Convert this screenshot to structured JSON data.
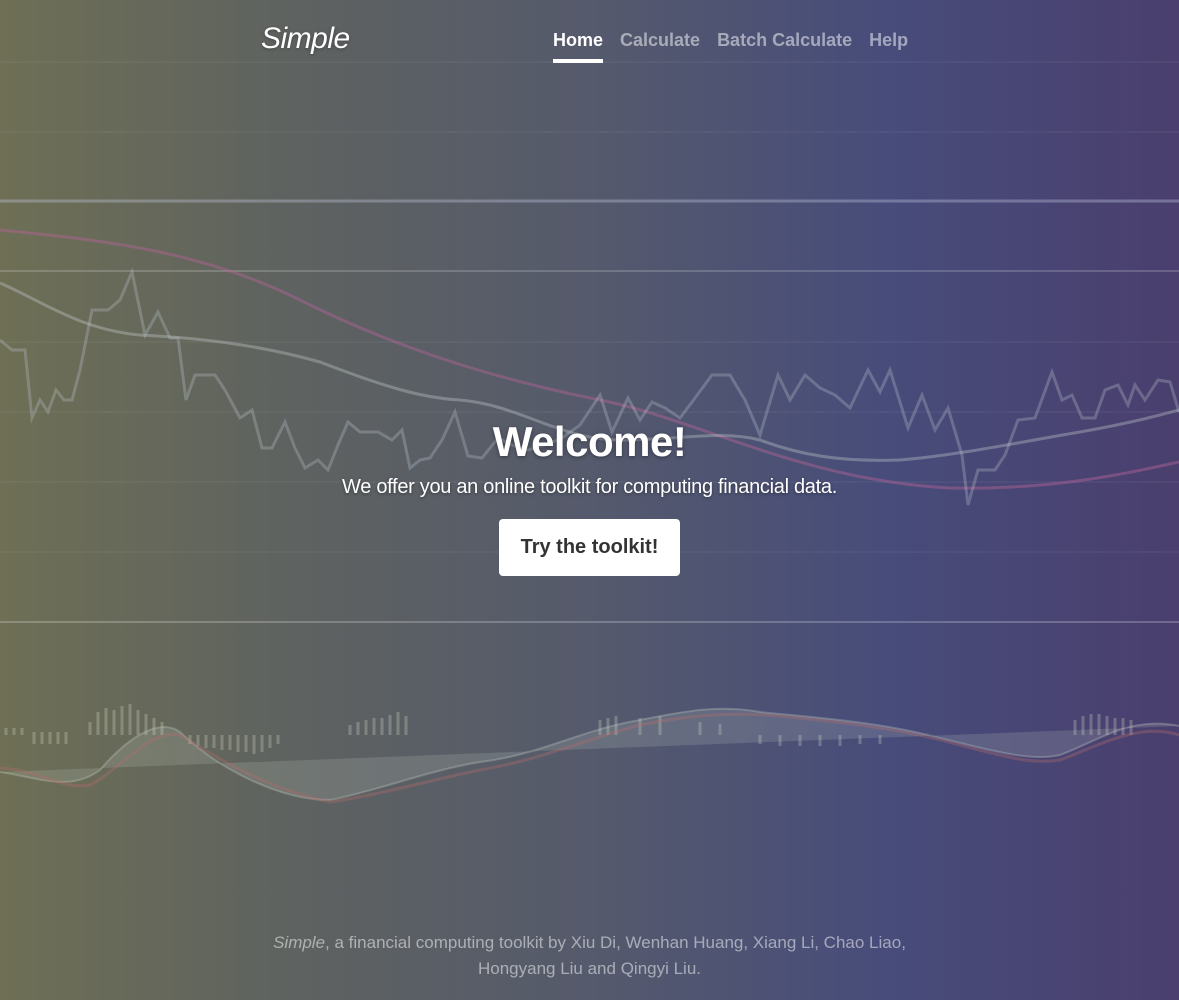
{
  "brand": "Simple",
  "nav": {
    "items": [
      {
        "label": "Home",
        "active": true
      },
      {
        "label": "Calculate",
        "active": false
      },
      {
        "label": "Batch Calculate",
        "active": false
      },
      {
        "label": "Help",
        "active": false
      }
    ]
  },
  "hero": {
    "title": "Welcome!",
    "subtitle": "We offer you an online toolkit for computing financial data.",
    "cta_label": "Try the toolkit!"
  },
  "footer": {
    "brand": "Simple",
    "text": ", a financial computing toolkit by Xiu Di, Wenhan Huang, Xiang Li, Chao Liao, Hongyang Liu and Qingyi Liu."
  },
  "colors": {
    "gradient_left": "#6e6f55",
    "gradient_right": "#4a3f6e",
    "text_primary": "#ffffff",
    "button_bg": "#ffffff",
    "button_text": "#333333"
  }
}
